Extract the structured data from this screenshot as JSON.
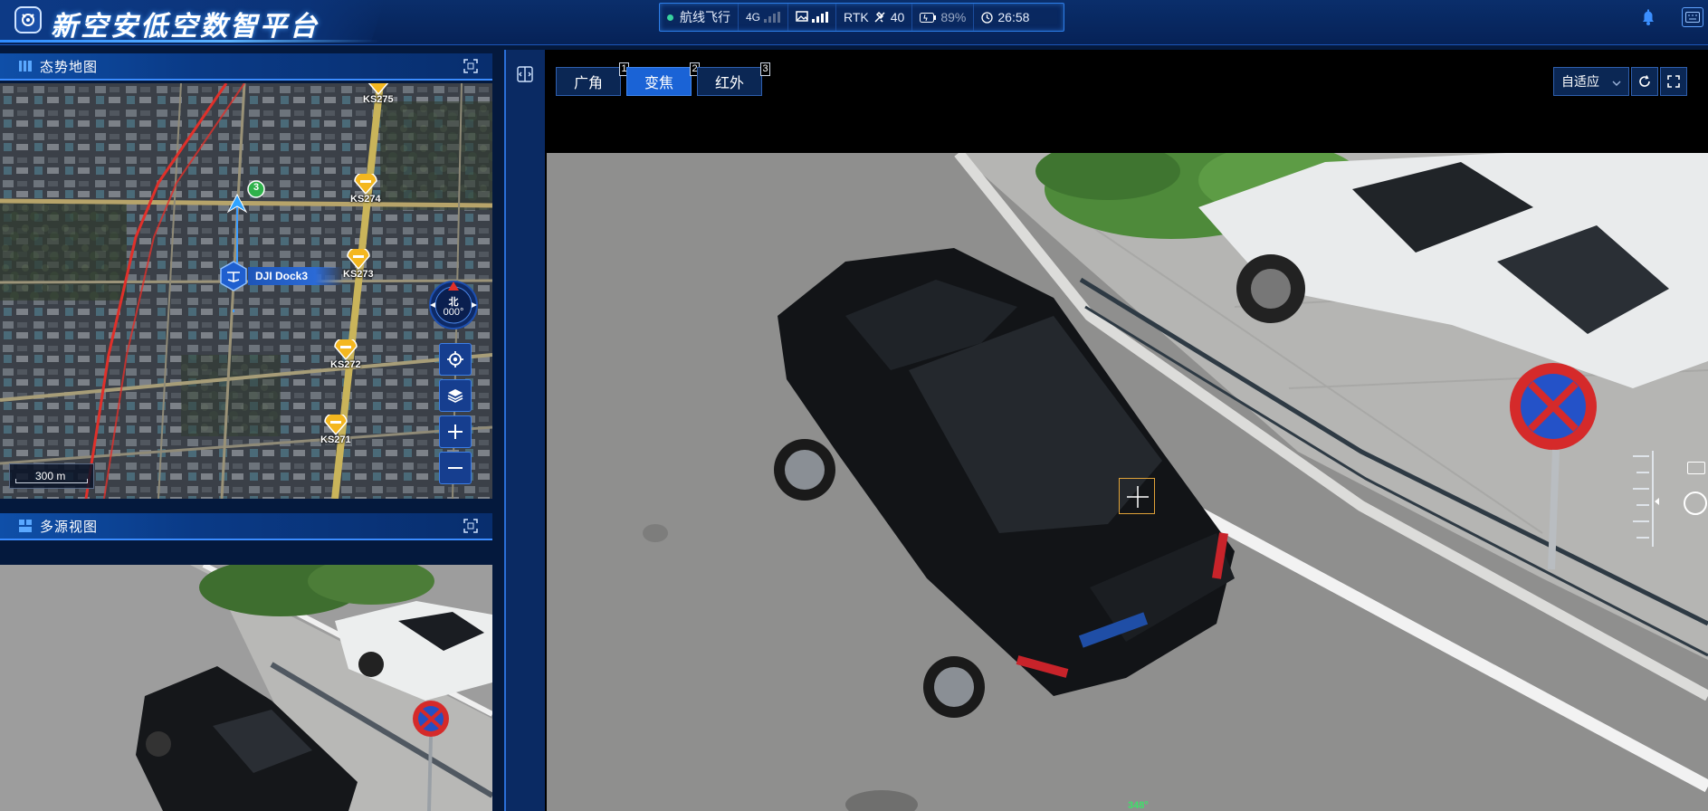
{
  "app": {
    "title": "新空安低空数智平台"
  },
  "status": {
    "flight_mode": "航线飞行",
    "net": "4G",
    "rtk_label": "RTK",
    "rtk_sats": "40",
    "battery": "89%",
    "time": "26:58"
  },
  "map_panel": {
    "title": "态势地图",
    "scale": "300 m",
    "compass_dir": "北",
    "compass_deg": "000°",
    "dock_label": "DJI Dock3",
    "drone_badge": "3",
    "waypoints": [
      "KS275",
      "KS274",
      "KS273",
      "KS272",
      "KS271"
    ]
  },
  "multi_panel": {
    "title": "多源视图"
  },
  "video": {
    "tabs": [
      {
        "label": "广角",
        "num": "1"
      },
      {
        "label": "变焦",
        "num": "2"
      },
      {
        "label": "红外",
        "num": "3"
      }
    ],
    "active_tab": "变焦",
    "fit_mode": "自适应",
    "heading": "348°"
  },
  "colors": {
    "accent": "#1a63d6",
    "pin": "#f4b71f",
    "route": "#e0302a"
  }
}
